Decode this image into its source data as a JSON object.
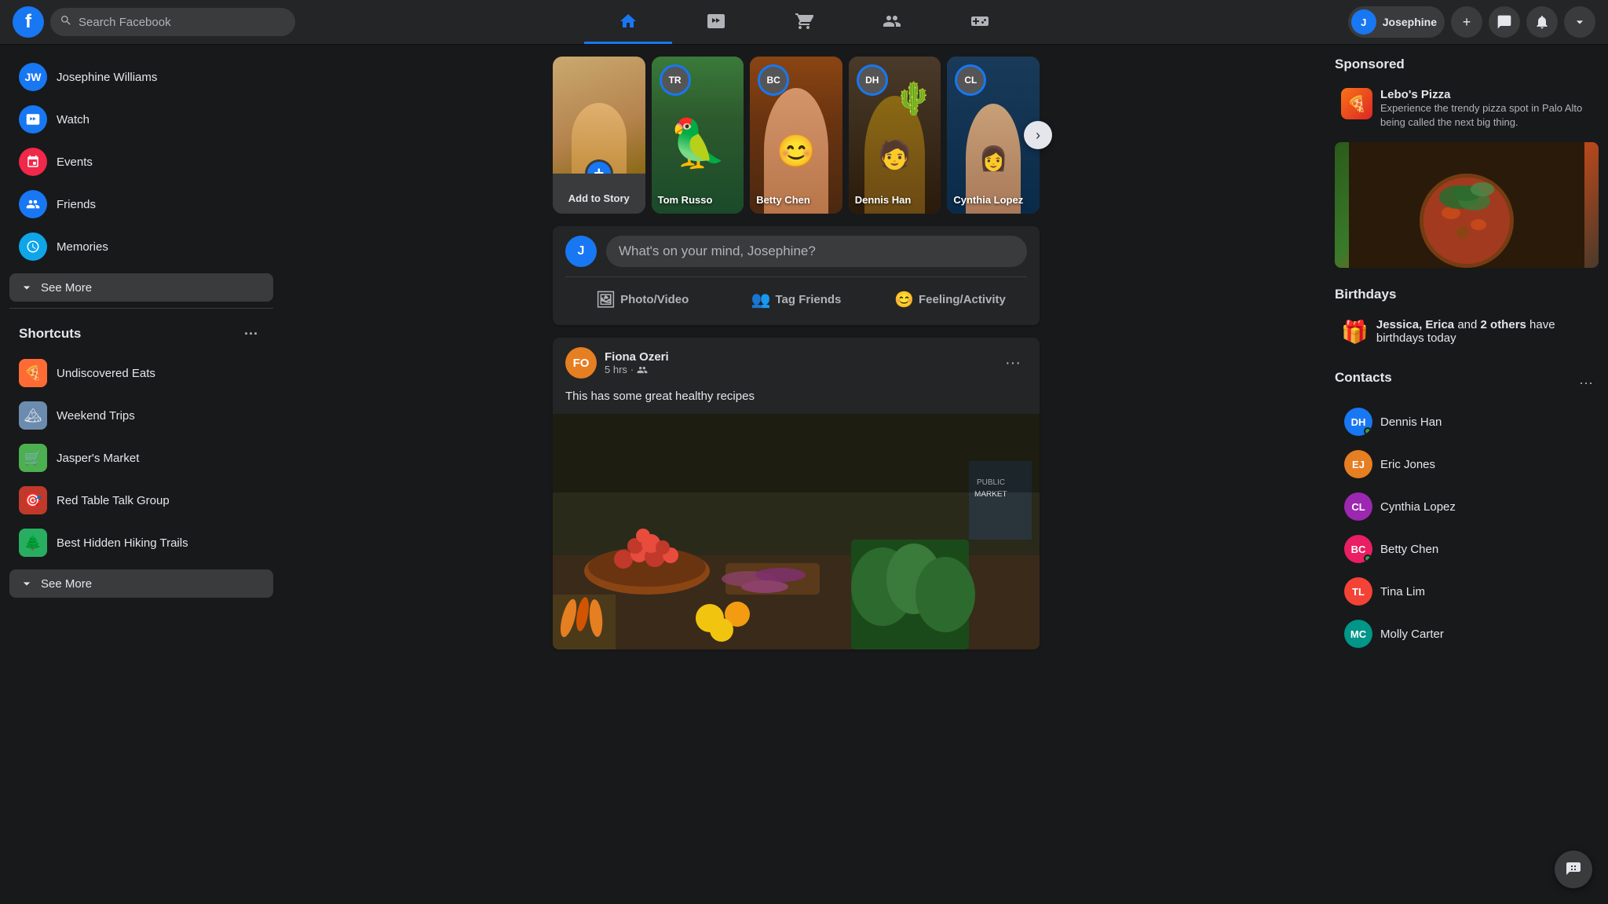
{
  "app": {
    "logo": "f",
    "search_placeholder": "Search Facebook"
  },
  "header": {
    "user": {
      "name": "Josephine",
      "avatar_initials": "J"
    },
    "nav_tabs": [
      {
        "id": "home",
        "label": "Home",
        "active": true
      },
      {
        "id": "watch",
        "label": "Watch",
        "active": false
      },
      {
        "id": "marketplace",
        "label": "Marketplace",
        "active": false
      },
      {
        "id": "groups",
        "label": "Groups",
        "active": false
      },
      {
        "id": "gaming",
        "label": "Gaming",
        "active": false
      }
    ],
    "icon_buttons": [
      {
        "id": "add",
        "icon": "+"
      },
      {
        "id": "messenger",
        "icon": "✉"
      },
      {
        "id": "notifications",
        "icon": "🔔"
      },
      {
        "id": "account",
        "icon": "▾"
      }
    ]
  },
  "sidebar_left": {
    "profile": {
      "name": "Josephine Williams",
      "initials": "JW"
    },
    "nav_items": [
      {
        "id": "watch",
        "label": "Watch",
        "icon": "▶",
        "color": "blue"
      },
      {
        "id": "events",
        "label": "Events",
        "icon": "★",
        "color": "red"
      },
      {
        "id": "friends",
        "label": "Friends",
        "icon": "👥",
        "color": "blue"
      },
      {
        "id": "memories",
        "label": "Memories",
        "icon": "🕐",
        "color": "teal"
      }
    ],
    "see_more": "See More",
    "shortcuts_title": "Shortcuts",
    "shortcuts": [
      {
        "id": "undiscovered-eats",
        "label": "Undiscovered Eats",
        "emoji": "🍕"
      },
      {
        "id": "weekend-trips",
        "label": "Weekend Trips",
        "emoji": "🏔"
      },
      {
        "id": "jaspers-market",
        "label": "Jasper's Market",
        "emoji": "🛒"
      },
      {
        "id": "red-table-talk",
        "label": "Red Table Talk Group",
        "emoji": "🎯"
      },
      {
        "id": "best-hidden",
        "label": "Best Hidden Hiking Trails",
        "emoji": "🌲"
      }
    ],
    "see_more_shortcuts": "See More"
  },
  "stories": [
    {
      "id": "add",
      "label": "Add to Story",
      "type": "add"
    },
    {
      "id": "tom",
      "name": "Tom Russo",
      "initials": "TR",
      "type": "person"
    },
    {
      "id": "betty",
      "name": "Betty Chen",
      "initials": "BC",
      "type": "person"
    },
    {
      "id": "dennis",
      "name": "Dennis Han",
      "initials": "DH",
      "type": "person"
    },
    {
      "id": "cynthia",
      "name": "Cynthia Lopez",
      "initials": "CL",
      "type": "person"
    }
  ],
  "post_box": {
    "placeholder": "What's on your mind, Josephine?",
    "user_initials": "J",
    "actions": [
      {
        "id": "photo-video",
        "label": "Photo/Video",
        "icon": "🖼"
      },
      {
        "id": "tag-friends",
        "label": "Tag Friends",
        "icon": "👤"
      },
      {
        "id": "feeling",
        "label": "Feeling/Activity",
        "icon": "😊"
      }
    ]
  },
  "feed": [
    {
      "id": "post1",
      "author": "Fiona Ozeri",
      "author_initials": "FO",
      "time": "5 hrs",
      "privacy": "friends",
      "text": "This has some great healthy recipes",
      "has_image": true,
      "image_type": "market"
    }
  ],
  "sidebar_right": {
    "sponsored": {
      "title": "Sponsored",
      "ad": {
        "name": "Lebo's Pizza",
        "description": "Experience the trendy pizza spot in Palo Alto being called the next big thing.",
        "icon": "🍕"
      }
    },
    "birthdays": {
      "title": "Birthdays",
      "text": "Jessica, Erica",
      "suffix": "and",
      "count": "2 others",
      "suffix2": "have birthdays today"
    },
    "contacts": {
      "title": "Contacts",
      "items": [
        {
          "id": "dennis-han",
          "name": "Dennis Han",
          "initials": "DH",
          "online": true,
          "color": "blue"
        },
        {
          "id": "eric-jones",
          "name": "Eric Jones",
          "initials": "EJ",
          "online": false,
          "color": "orange"
        },
        {
          "id": "cynthia-lopez",
          "name": "Cynthia Lopez",
          "initials": "CL",
          "online": false,
          "color": "purple"
        },
        {
          "id": "betty-chen",
          "name": "Betty Chen",
          "initials": "BC",
          "online": true,
          "color": "pink"
        },
        {
          "id": "tina-lim",
          "name": "Tina Lim",
          "initials": "TL",
          "online": false,
          "color": "red"
        },
        {
          "id": "molly-carter",
          "name": "Molly Carter",
          "initials": "MC",
          "online": false,
          "color": "teal"
        }
      ]
    }
  }
}
